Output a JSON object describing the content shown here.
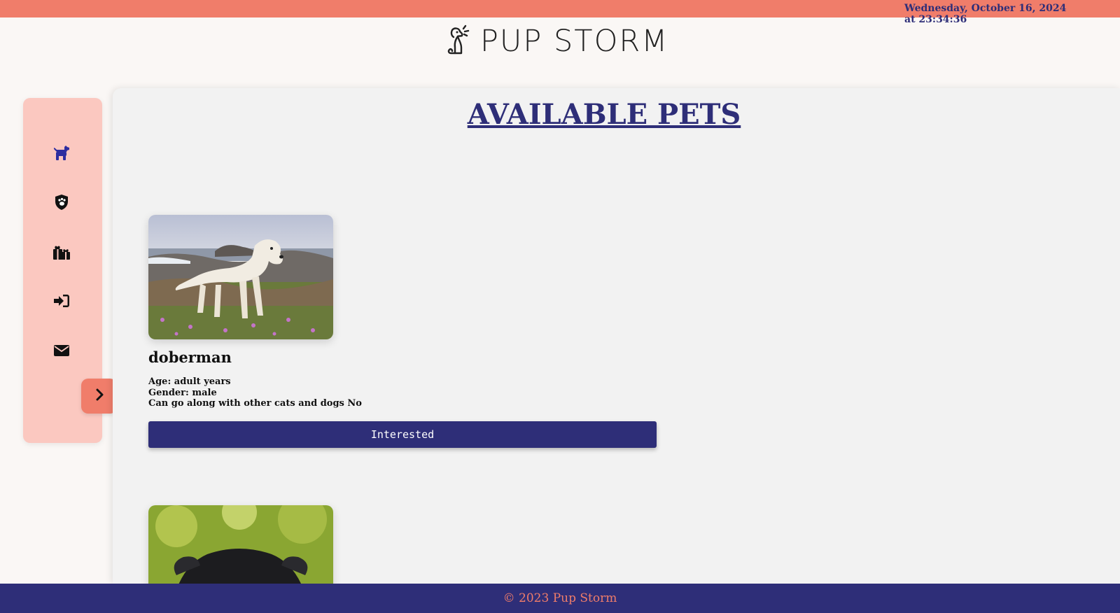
{
  "header": {
    "datetime": "Wednesday, October 16, 2024 at 23:34:36",
    "brand_name": "PUP STORM"
  },
  "sidebar": {
    "items": [
      {
        "icon": "dog-icon",
        "color": "#2e2ea0"
      },
      {
        "icon": "shield-paw-icon",
        "color": "#111111"
      },
      {
        "icon": "gift-icon",
        "color": "#111111"
      },
      {
        "icon": "login-icon",
        "color": "#111111"
      },
      {
        "icon": "envelope-icon",
        "color": "#111111"
      }
    ],
    "toggle_icon": "chevron-right-icon"
  },
  "main": {
    "title": "AVAILABLE PETS",
    "pets": [
      {
        "name": "doberman",
        "age": "Age: adult years",
        "gender": "Gender: male",
        "compat": "Can go along with other cats and dogs No",
        "button_label": "Interested"
      }
    ]
  },
  "footer": {
    "text": "© 2023 Pup Storm"
  },
  "colors": {
    "accent": "#f07d6a",
    "primary": "#2e2e78",
    "sidebar_bg": "#fbc8c0",
    "main_bg": "#f2f2f2"
  }
}
